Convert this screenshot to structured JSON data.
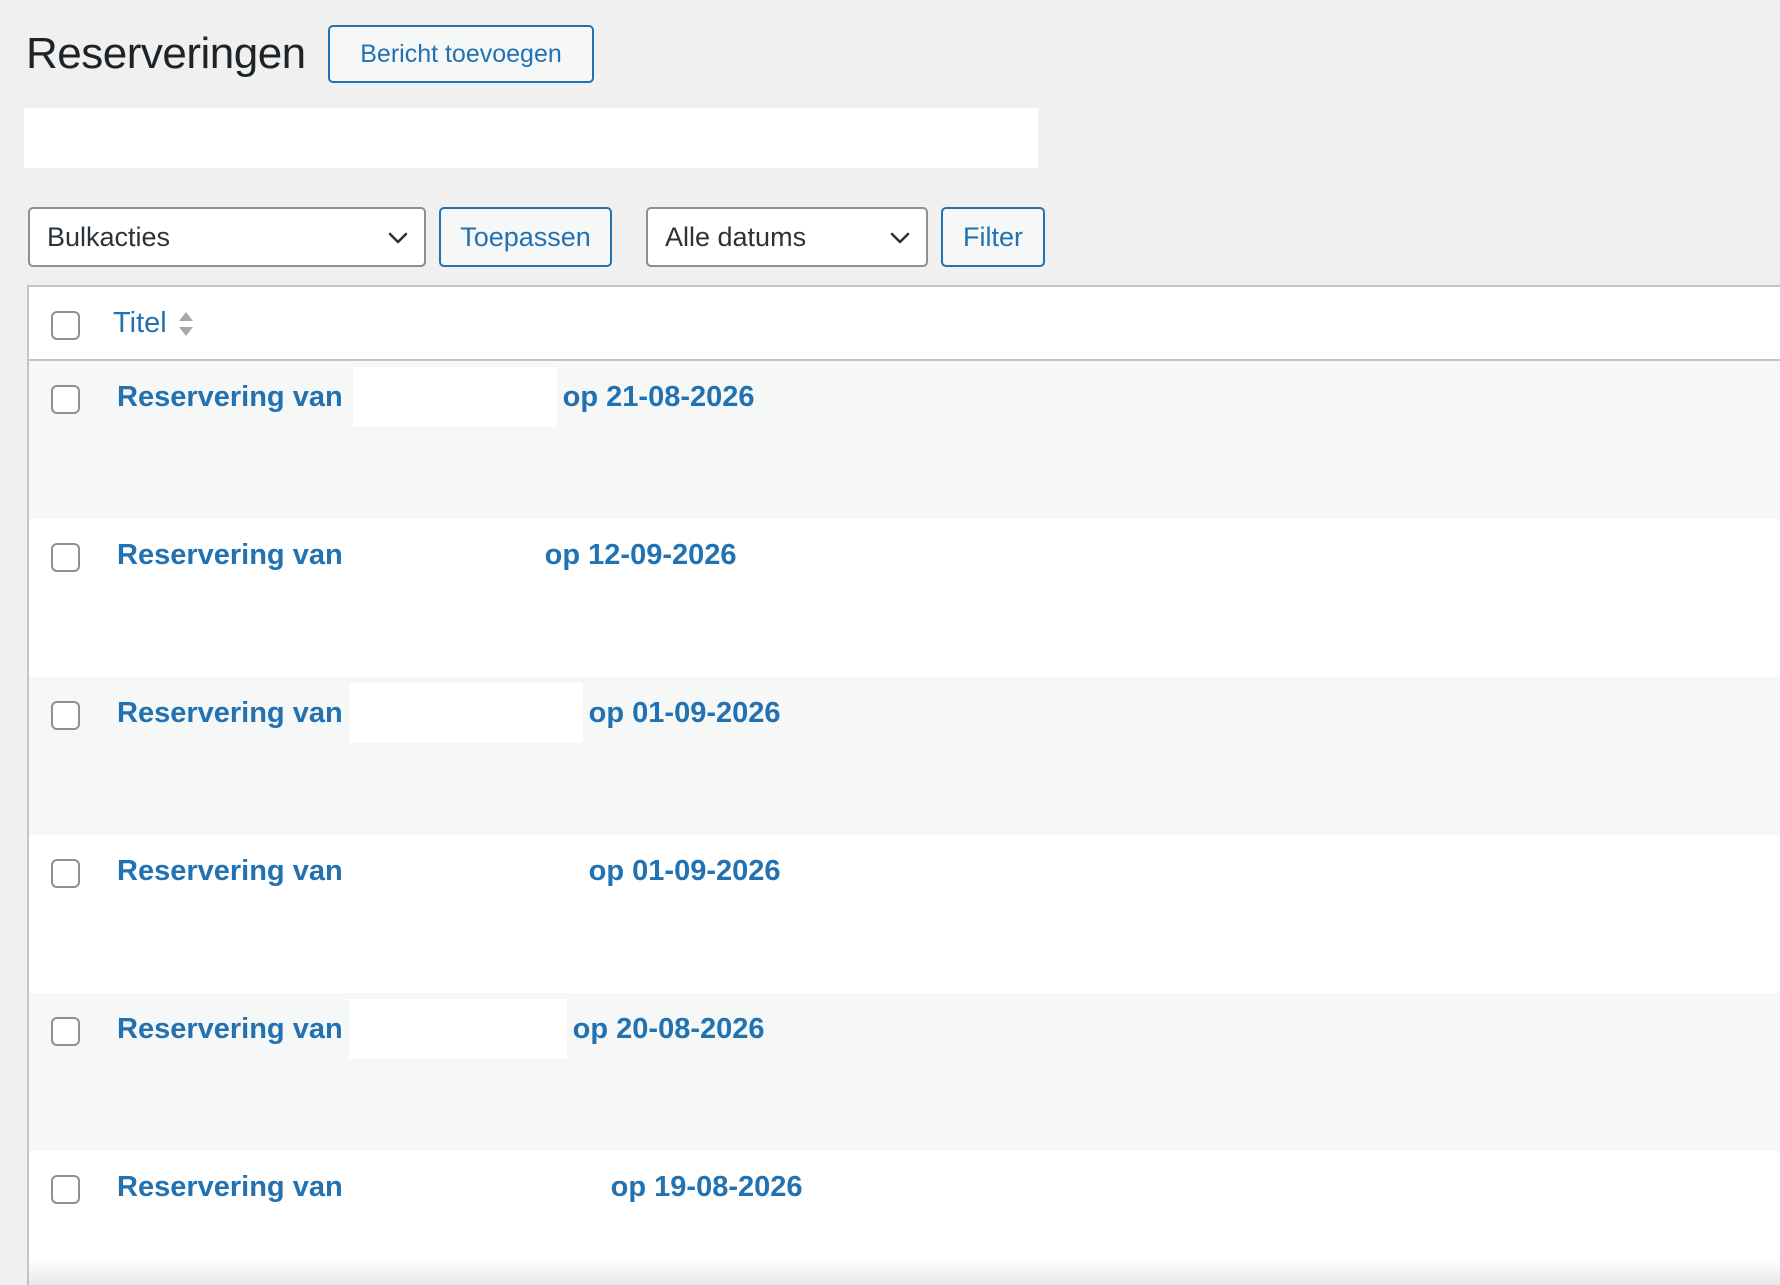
{
  "page": {
    "title": "Reserveringen",
    "add_new_label": "Bericht toevoegen"
  },
  "toolbar": {
    "bulk_actions": "Bulkacties",
    "apply_label": "Toepassen",
    "dates": "Alle datums",
    "filter_label": "Filter"
  },
  "table": {
    "column_title": "Titel",
    "rows": [
      {
        "prefix": "Reservering van",
        "suffix": "op 21-08-2026"
      },
      {
        "prefix": "Reservering van",
        "suffix": "op 12-09-2026"
      },
      {
        "prefix": "Reservering van",
        "suffix": "op 01-09-2026"
      },
      {
        "prefix": "Reservering van",
        "suffix": "op 01-09-2026"
      },
      {
        "prefix": "Reservering van",
        "suffix": "op 20-08-2026"
      },
      {
        "prefix": "Reservering van",
        "suffix": "op 19-08-2026"
      }
    ]
  },
  "colors": {
    "accent": "#2271b1",
    "background": "#f0f0f1",
    "row_alt": "#f6f7f7"
  },
  "icons": {
    "dropdown": "chevron-down-icon",
    "sort": "sort-arrows-icon"
  }
}
